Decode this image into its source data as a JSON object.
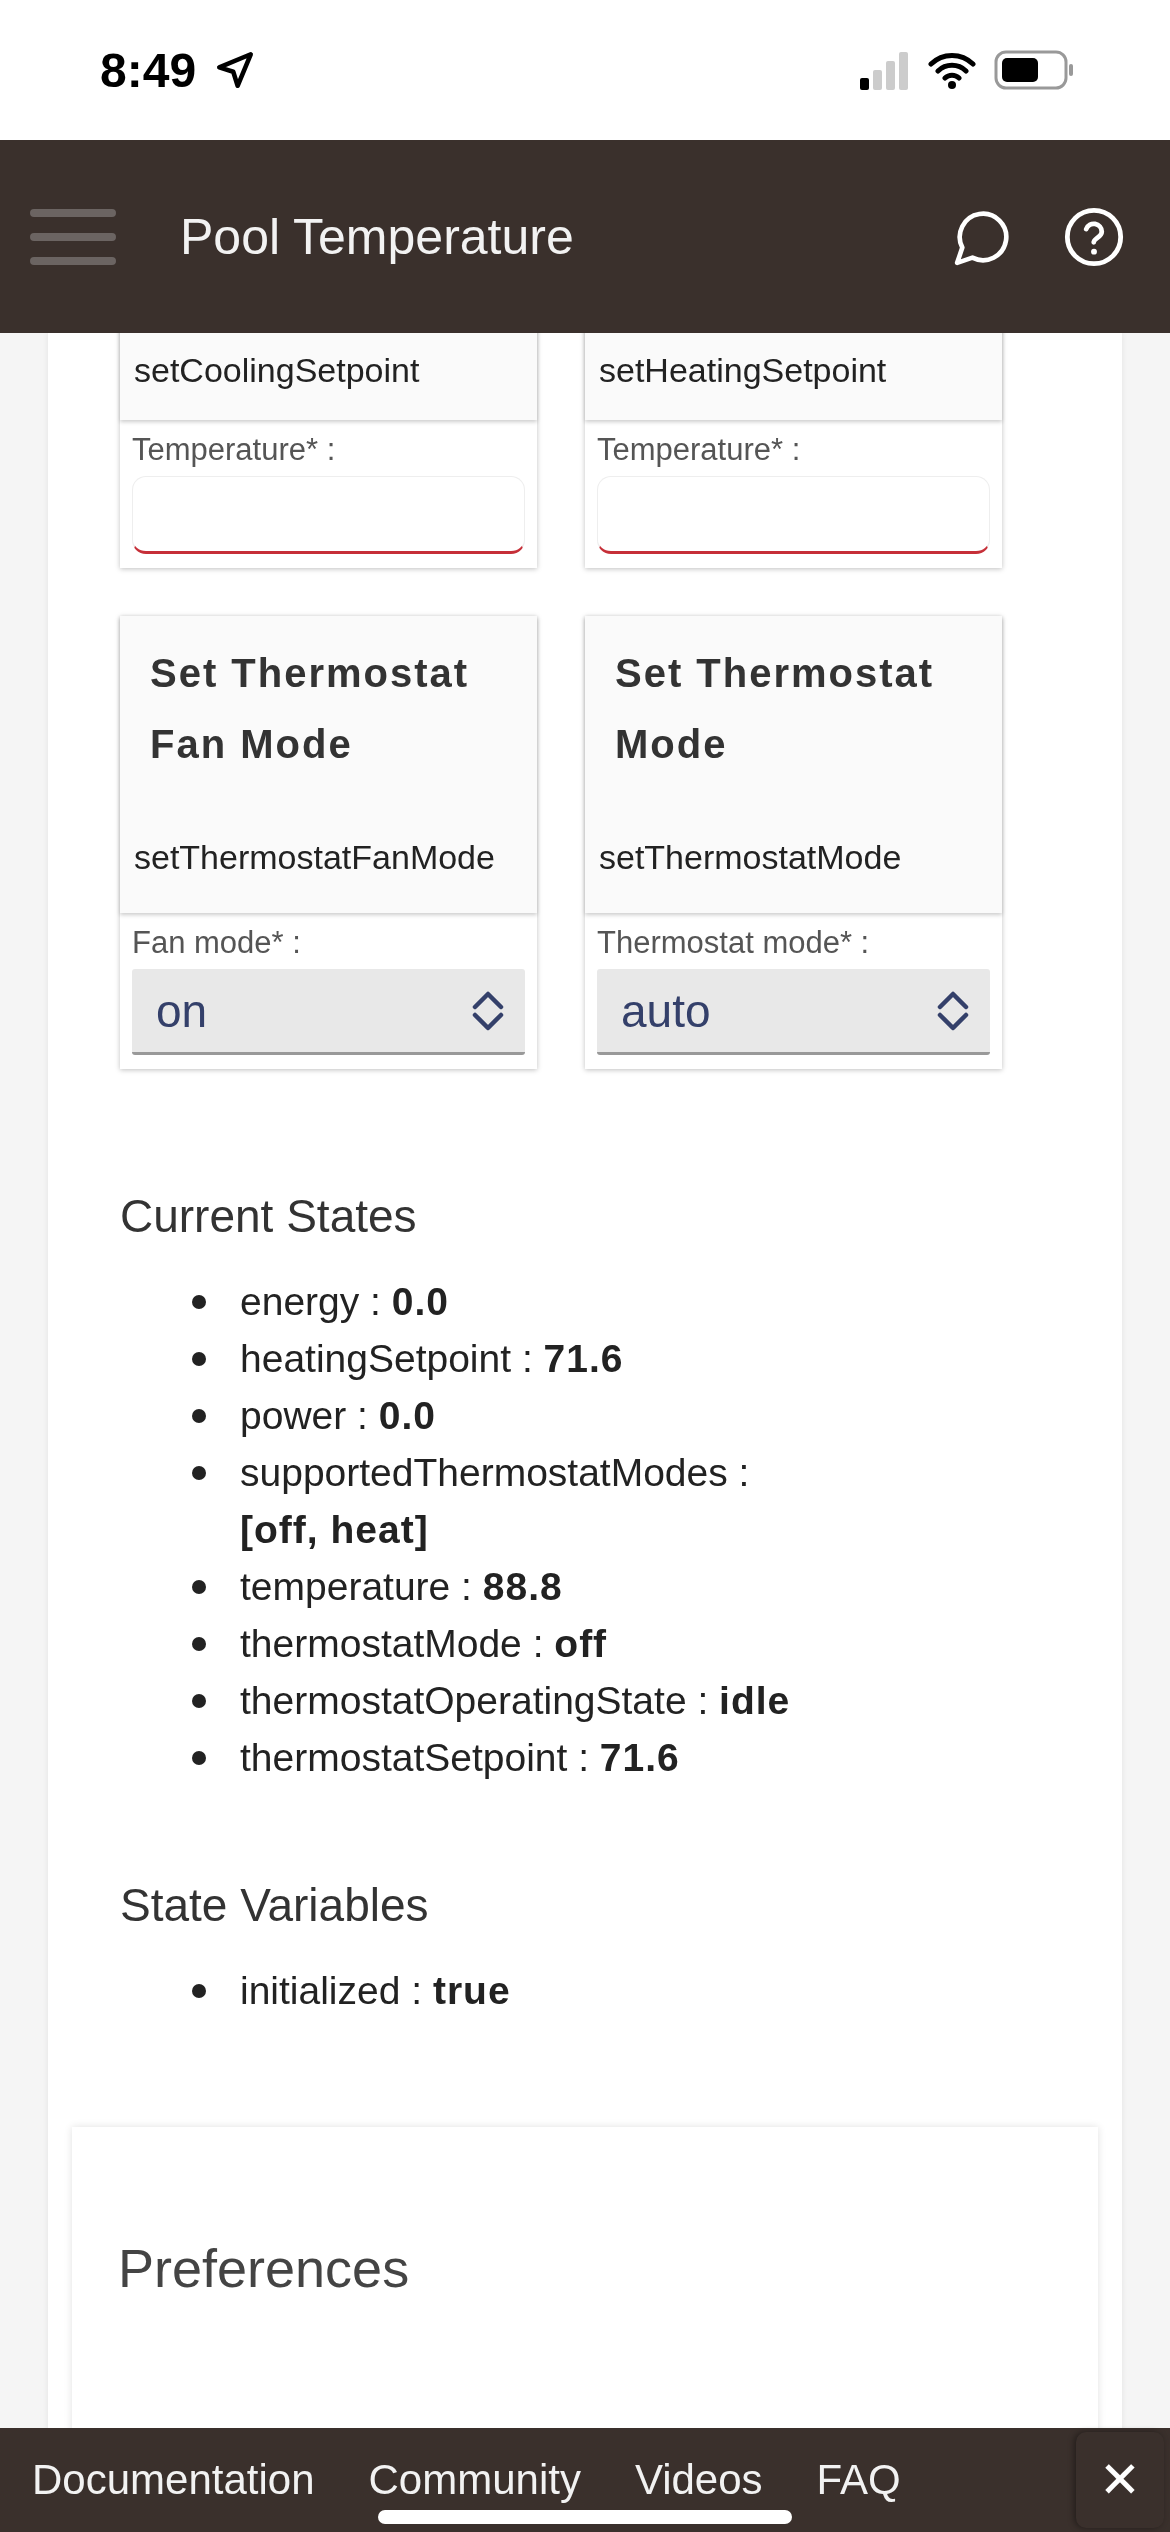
{
  "status_bar": {
    "time": "8:49"
  },
  "header": {
    "title": "Pool Temperature"
  },
  "command_cards": [
    {
      "method": "setCoolingSetpoint",
      "field_label": "Temperature* :",
      "field": {
        "kind": "input"
      }
    },
    {
      "method": "setHeatingSetpoint",
      "field_label": "Temperature* :",
      "field": {
        "kind": "input"
      }
    },
    {
      "title": "Set Thermostat Fan Mode",
      "method": "setThermostatFanMode",
      "field_label": "Fan mode* :",
      "field": {
        "kind": "select",
        "value": "on"
      }
    },
    {
      "title": "Set Thermostat Mode",
      "method": "setThermostatMode",
      "field_label": "Thermostat mode* :",
      "field": {
        "kind": "select",
        "value": "auto"
      }
    }
  ],
  "current_states": {
    "heading": "Current States",
    "items": [
      "energy : **0.0**",
      "heatingSetpoint : **71.6**",
      "power : **0.0**",
      "supportedThermostatModes : **[off, heat]**",
      "temperature : **88.8**",
      "thermostatMode : **off**",
      "thermostatOperatingState : **idle**",
      "thermostatSetpoint : **71.6**"
    ]
  },
  "state_variables": {
    "heading": "State Variables",
    "items": [
      "initialized : **true**"
    ]
  },
  "preferences": {
    "title": "Preferences"
  },
  "bottom_nav": {
    "links": [
      "Documentation",
      "Community",
      "Videos",
      "FAQ"
    ],
    "close": "✕"
  }
}
